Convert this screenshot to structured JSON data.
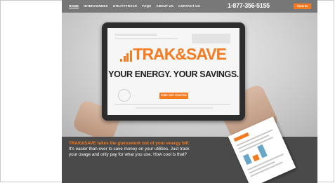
{
  "nav": {
    "items": [
      "HOME",
      "INTERCONNEX",
      "UTILITYTRACK",
      "FAQs",
      "ABOUT US",
      "CONTACT US"
    ],
    "phone": "1-877-356-5155",
    "signin": "SIGN IN"
  },
  "hero": {
    "logo_text": "TRAK&SAVE",
    "tagline": "YOUR ENERGY. YOUR SAVINGS.",
    "cta": "FREE! GET STARTED"
  },
  "promo": {
    "headline": "TRAK&SAVE takes the guesswork out of your energy bill.",
    "lines": [
      "It's easier than ever to save money on your utilities. Just track",
      "your usage and only pay for what you use. How cool is that?"
    ]
  },
  "colors": {
    "accent": "#f47b20",
    "dark_band": "#4a4a4a"
  }
}
